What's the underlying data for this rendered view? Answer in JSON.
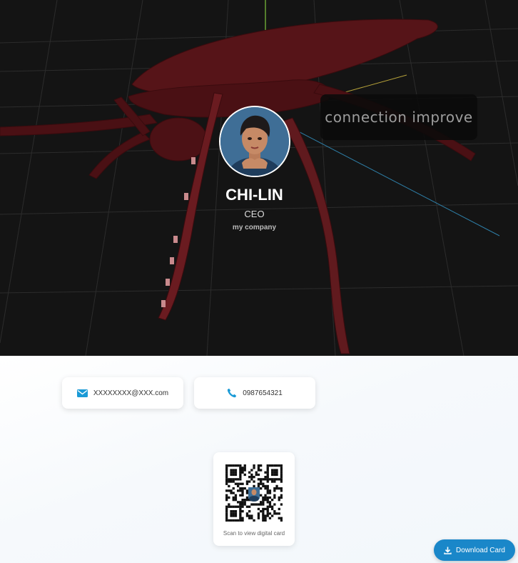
{
  "overlay_label": "connection improve",
  "profile": {
    "name": "CHI-LIN",
    "title": "CEO",
    "company": "my company",
    "avatar_icon": "person-portrait-icon"
  },
  "contacts": {
    "email": {
      "icon": "envelope-icon",
      "value": "XXXXXXXX@XXX.com"
    },
    "phone": {
      "icon": "phone-icon",
      "value": "0987654321"
    }
  },
  "qr": {
    "caption": "Scan to view digital card"
  },
  "download": {
    "label": "Download Card",
    "icon": "download-icon"
  },
  "colors": {
    "accent": "#1a87c9",
    "scene_bg": "#141414",
    "model": "#5a1418",
    "icon_blue": "#1a9ad6"
  }
}
